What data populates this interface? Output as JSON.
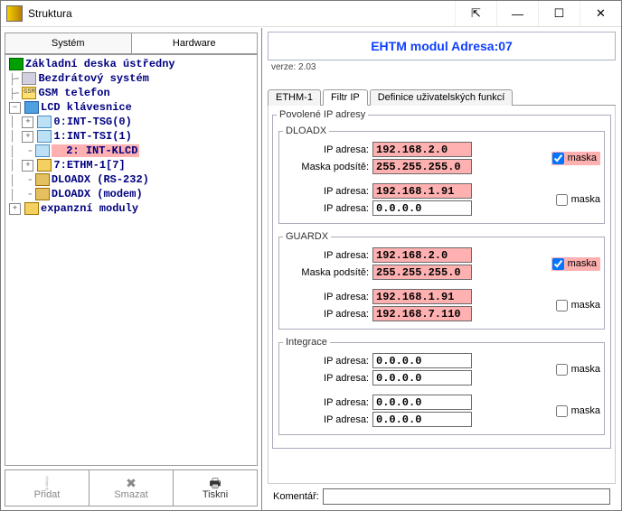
{
  "window": {
    "title": "Struktura"
  },
  "left_tabs": {
    "system": "Systém",
    "hardware": "Hardware"
  },
  "tree": {
    "n0": "Základní deska ústředny",
    "n1": "Bezdrátový systém",
    "n2": "GSM telefon",
    "n3": "LCD klávesnice",
    "n4a": "0:",
    "n4b": "INT-TSG",
    "n4c": "(0)",
    "n5a": "1:",
    "n5b": "INT-TSI",
    "n5c": "(1)",
    "n6a": "2:",
    "n6b": "INT-KLCD",
    "n7a": "7:",
    "n7b": "ETHM-1",
    "n7c": "[7]",
    "n8": "DLOADX (RS-232)",
    "n9": "DLOADX (modem)",
    "n10": "expanzní moduly"
  },
  "toolbar": {
    "add": "Přidat",
    "del": "Smazat",
    "print": "Tiskni"
  },
  "header": {
    "title": "EHTM modul Adresa:07",
    "version_label": "verze:",
    "version": "2.03"
  },
  "right_tabs": {
    "t1": "ETHM-1",
    "t2": "Filtr IP",
    "t3": "Definice uživatelských funkcí"
  },
  "labels": {
    "group_main": "Povolené IP adresy",
    "dloadx": "DLOADX",
    "guardx": "GUARDX",
    "integrace": "Integrace",
    "ip": "IP adresa:",
    "mask": "Maska podsítě:",
    "chk": "maska",
    "komentar": "Komentář:"
  },
  "values": {
    "dloadx": {
      "ip1": "192.168.2.0",
      "mask1": "255.255.255.0",
      "ip2": "192.168.1.91",
      "ip3": "0.0.0.0",
      "chk1": true,
      "chk2": false
    },
    "guardx": {
      "ip1": "192.168.2.0",
      "mask1": "255.255.255.0",
      "ip2": "192.168.1.91",
      "ip3": "192.168.7.110",
      "chk1": true,
      "chk2": false
    },
    "integ": {
      "ip1": "0.0.0.0",
      "ip2": "0.0.0.0",
      "ip3": "0.0.0.0",
      "ip4": "0.0.0.0",
      "chk1": false,
      "chk2": false
    },
    "komentar": ""
  }
}
